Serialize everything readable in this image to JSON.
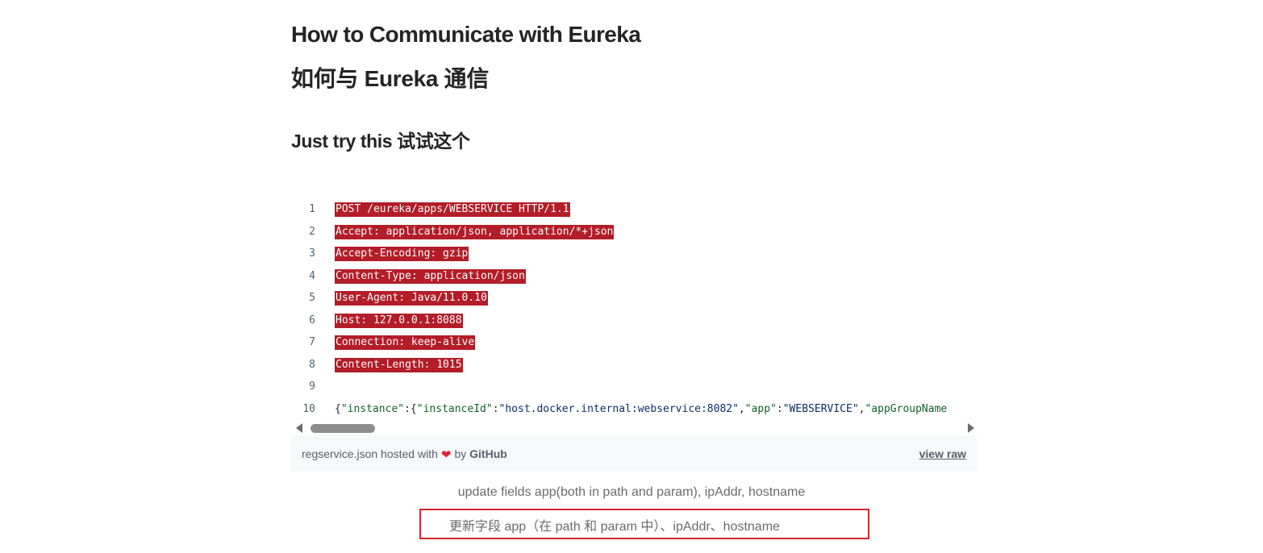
{
  "article": {
    "title_en": "How to Communicate with Eureka",
    "title_zh": "如何与 Eureka 通信",
    "subtitle": "Just try this  试试这个"
  },
  "gist": {
    "lines": [
      {
        "num": "1",
        "text": "POST /eureka/apps/WEBSERVICE HTTP/1.1"
      },
      {
        "num": "2",
        "text": "Accept: application/json, application/*+json"
      },
      {
        "num": "3",
        "text": "Accept-Encoding: gzip"
      },
      {
        "num": "4",
        "text": "Content-Type: application/json"
      },
      {
        "num": "5",
        "text": "User-Agent: Java/11.0.10"
      },
      {
        "num": "6",
        "text": "Host: 127.0.0.1:8088"
      },
      {
        "num": "7",
        "text": "Connection: keep-alive"
      },
      {
        "num": "8",
        "text": "Content-Length: 1015"
      },
      {
        "num": "9",
        "text": ""
      },
      {
        "num": "10",
        "text": "{\"instance\":{\"instanceId\":\"host.docker.internal:webservice:8082\",\"app\":\"WEBSERVICE\",\"appGroupName"
      }
    ],
    "json_tokens": {
      "p1": "{",
      "k1": "\"instance\"",
      "p2": ":{",
      "k2": "\"instanceId\"",
      "p3": ":",
      "s1": "\"host.docker.internal:webservice:8082\"",
      "p4": ",",
      "k3": "\"app\"",
      "p5": ":",
      "s2": "\"WEBSERVICE\"",
      "p6": ",",
      "k4": "\"appGroupName"
    },
    "meta": {
      "filename": "regservice.json",
      "hosted_with": "hosted with",
      "by": "by",
      "host": "GitHub",
      "view_raw": "view raw"
    }
  },
  "caption": {
    "en": "update fields app(both in path and param), ipAddr, hostname",
    "zh": "更新字段 app（在 path 和 param 中）、ipAddr、hostname"
  },
  "colors": {
    "error_bg": "#b31d28",
    "highlight_box": "#d7262c",
    "heart": "#e5223a"
  }
}
